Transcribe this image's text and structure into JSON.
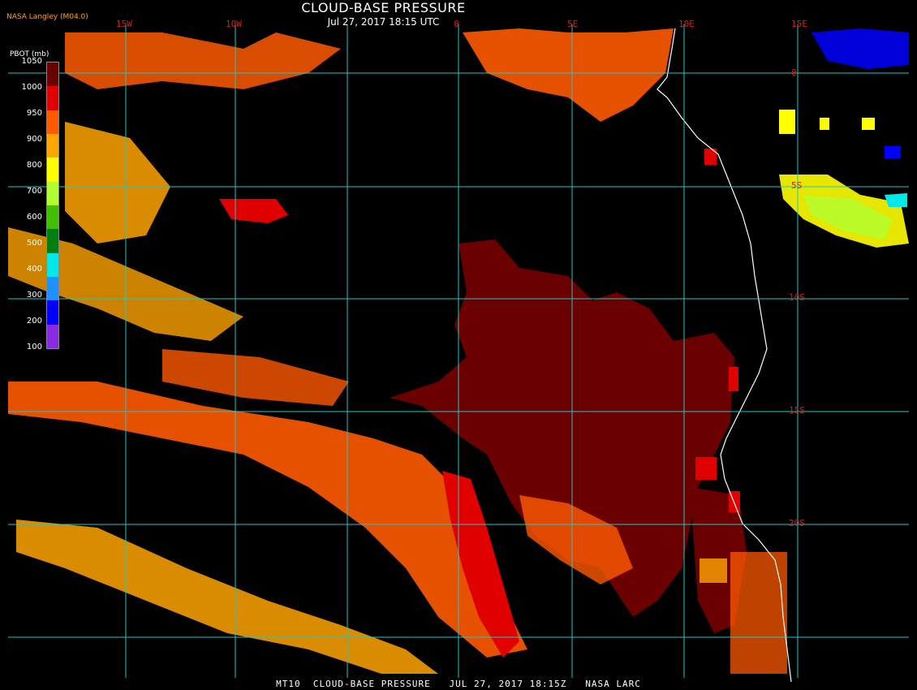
{
  "header": {
    "title": "CLOUD-BASE PRESSURE",
    "subtitle": "Jul 27, 2017 18:15 UTC",
    "source": "NASA Langley (M04.0)"
  },
  "lon_labels": [
    "15W",
    "10W",
    "0",
    "5E",
    "10E",
    "15E"
  ],
  "lat_labels": [
    "0",
    "5S",
    "10S",
    "15S",
    "20S"
  ],
  "legend": {
    "unit": "PBOT (mb)",
    "ticks": [
      "1050",
      "1000",
      "950",
      "900",
      "800",
      "700",
      "600",
      "500",
      "400",
      "300",
      "200",
      "100"
    ],
    "colors": [
      "#6b0000",
      "#e00000",
      "#ff5a00",
      "#ffa500",
      "#ffff00",
      "#b0ff30",
      "#40c000",
      "#007f10",
      "#00e8e8",
      "#1e90ff",
      "#0000ff",
      "#8a2be2"
    ]
  },
  "footer": "MT10  CLOUD-BASE PRESSURE   JUL 27, 2017 18:15Z   NASA LARC",
  "colors": {
    "background": "#000000",
    "grid": "#20c8c8",
    "coast": "#ffffff",
    "low_cloud_dark": "#6b0000",
    "low_cloud_red": "#e00000",
    "mid_orange": "#ff5a00",
    "orange": "#ffa500",
    "high_yellow": "#ffff00",
    "high_green": "#b0ff30",
    "high_blue": "#0000ff"
  }
}
